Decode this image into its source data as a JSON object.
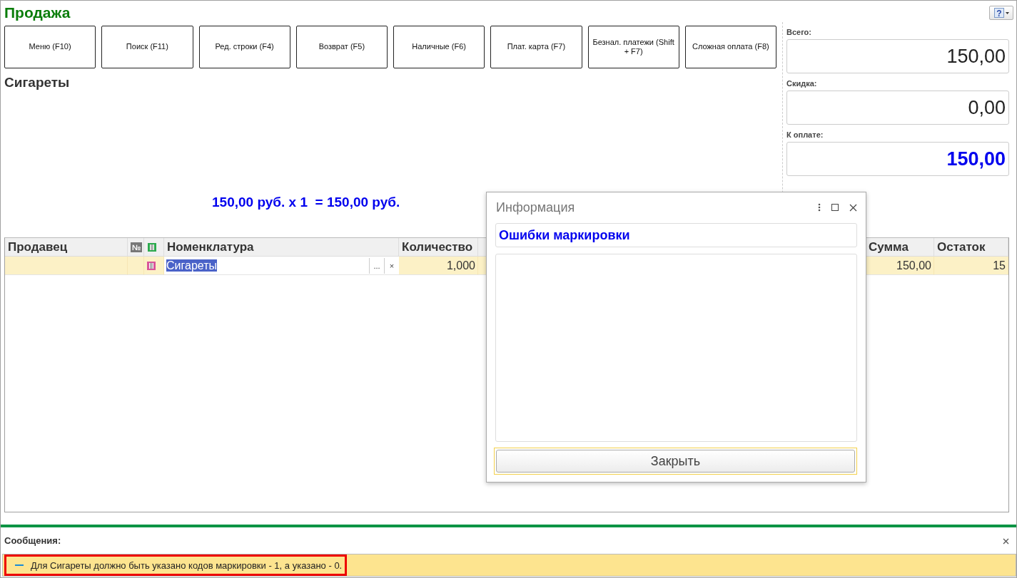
{
  "form": {
    "title": "Продажа",
    "help": "?"
  },
  "buttons": [
    "Меню (F10)",
    "Поиск (F11)",
    "Ред. строки (F4)",
    "Возврат (F5)",
    "Наличные (F6)",
    "Плат. карта (F7)",
    "Безнал. платежи (Shift + F7)",
    "Сложная оплата (F8)"
  ],
  "product_title": "Сигареты",
  "price_line": "150,00 руб. x 1  = 150,00 руб.",
  "totals": [
    {
      "label": "Всего:",
      "value": "150,00",
      "emphasis": false
    },
    {
      "label": "Скидка:",
      "value": "0,00",
      "emphasis": false
    },
    {
      "label": "К оплате:",
      "value": "150,00",
      "emphasis": true
    }
  ],
  "table": {
    "columns": [
      {
        "kind": "text",
        "label": "Продавец"
      },
      {
        "kind": "symbol",
        "label": "№"
      },
      {
        "kind": "icon"
      },
      {
        "kind": "text",
        "label": "Номенклатура"
      },
      {
        "kind": "text",
        "label": "Количество"
      },
      {
        "kind": "text",
        "label": "Сумма"
      },
      {
        "kind": "text",
        "label": "Остаток"
      }
    ],
    "rows": [
      {
        "selected": true,
        "editing": true,
        "item": "Сигареты",
        "select_label": "...",
        "clear_label": "×",
        "quantity": "1,000",
        "sum": "150,00",
        "remainder": "15"
      }
    ]
  },
  "dialog": {
    "title": "Информация",
    "heading": "Ошибки маркировки",
    "button": "Закрыть"
  },
  "messages": {
    "title": "Сообщения:",
    "items": [
      {
        "text": "Для Сигареты должно быть указано кодов маркировки - 1, а указано - 0.",
        "highlighted": true
      }
    ]
  }
}
